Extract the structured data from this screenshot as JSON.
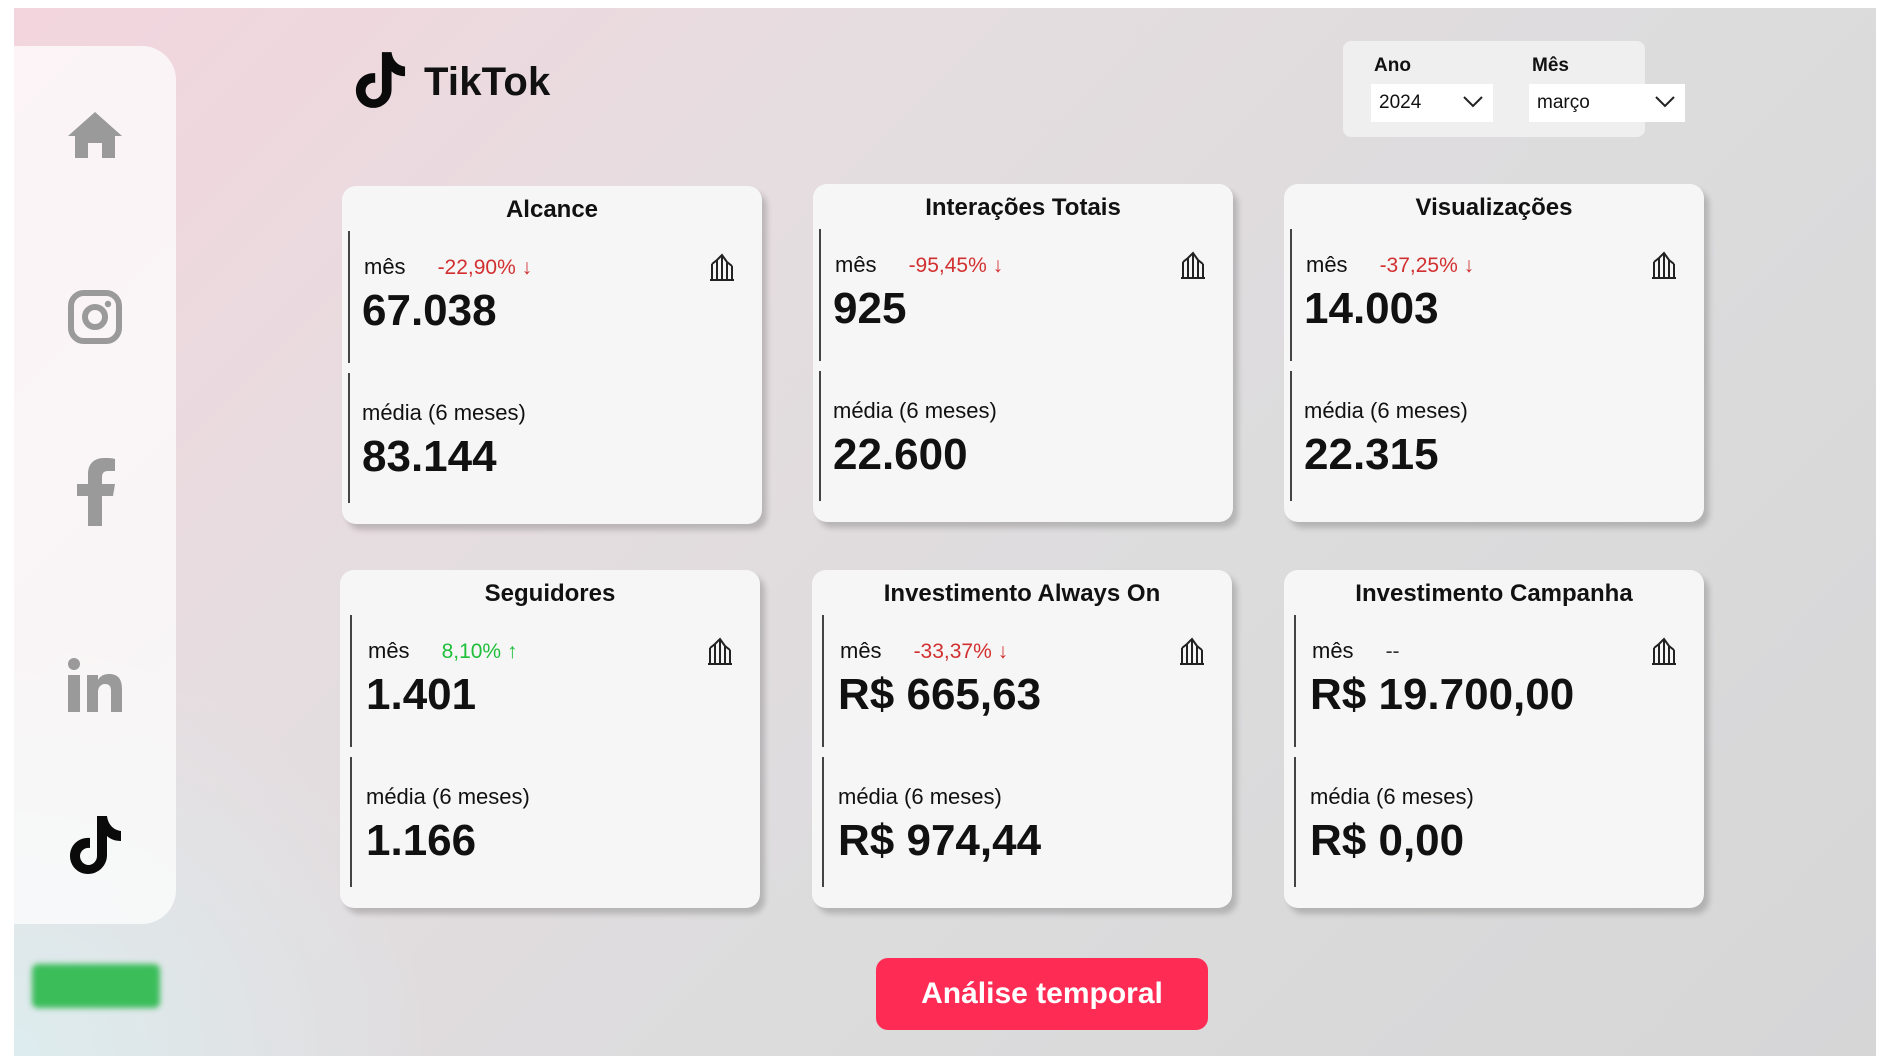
{
  "brand": {
    "title": "TikTok",
    "icon": "tiktok-logo-icon"
  },
  "sidebar": {
    "items": [
      {
        "name": "home",
        "icon": "home-icon"
      },
      {
        "name": "instagram",
        "icon": "instagram-icon"
      },
      {
        "name": "facebook",
        "icon": "facebook-icon"
      },
      {
        "name": "linkedin",
        "icon": "linkedin-icon"
      },
      {
        "name": "tiktok",
        "icon": "tiktok-icon",
        "active": true
      }
    ]
  },
  "filters": {
    "ano": {
      "label": "Ano",
      "value": "2024"
    },
    "mes": {
      "label": "Mês",
      "value": "março"
    }
  },
  "cards": [
    {
      "title": "Alcance",
      "mes_label": "mês",
      "delta": "-22,90% ↓",
      "delta_dir": "down",
      "mes_value": "67.038",
      "avg_label": "média (6 meses)",
      "avg_value": "83.144"
    },
    {
      "title": "Interações Totais",
      "mes_label": "mês",
      "delta": "-95,45% ↓",
      "delta_dir": "down",
      "mes_value": "925",
      "avg_label": "média (6 meses)",
      "avg_value": "22.600"
    },
    {
      "title": "Visualizações",
      "mes_label": "mês",
      "delta": "-37,25% ↓",
      "delta_dir": "down",
      "mes_value": "14.003",
      "avg_label": "média (6 meses)",
      "avg_value": "22.315"
    },
    {
      "title": "Seguidores",
      "mes_label": "mês",
      "delta": "8,10% ↑",
      "delta_dir": "up",
      "mes_value": "1.401",
      "avg_label": "média (6 meses)",
      "avg_value": "1.166"
    },
    {
      "title": "Investimento Always On",
      "mes_label": "mês",
      "delta": "-33,37% ↓",
      "delta_dir": "down",
      "mes_value": "R$ 665,63",
      "avg_label": "média (6 meses)",
      "avg_value": "R$ 974,44"
    },
    {
      "title": "Investimento Campanha",
      "mes_label": "mês",
      "delta": "--",
      "delta_dir": "neutral",
      "mes_value": "R$ 19.700,00",
      "avg_label": "média (6 meses)",
      "avg_value": "R$ 0,00"
    }
  ],
  "cta": {
    "label": "Análise temporal",
    "color": "#fe2c55"
  },
  "colors": {
    "down": "#d23030",
    "up": "#1fbf3a",
    "accent": "#fe2c55"
  }
}
